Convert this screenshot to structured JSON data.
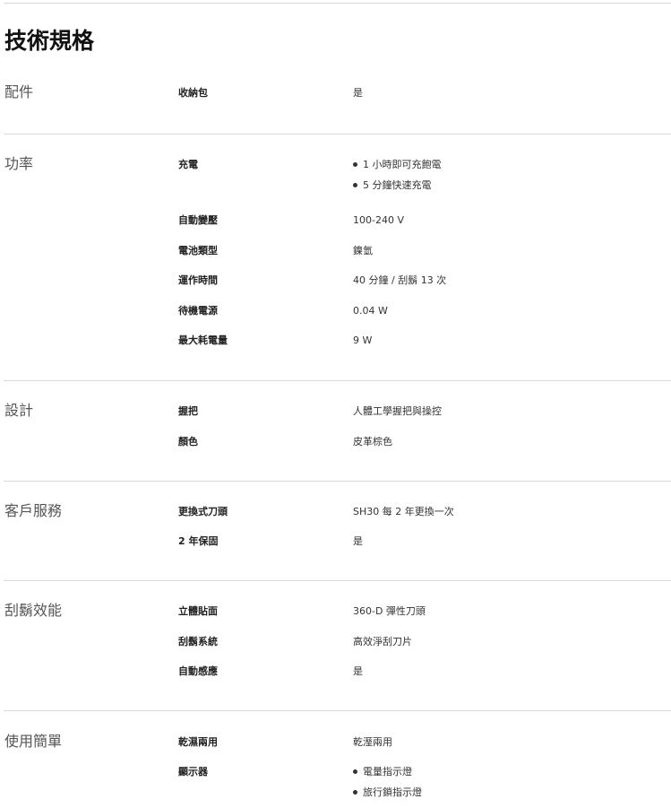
{
  "title": "技術規格",
  "sections": [
    {
      "name": "配件",
      "rows": [
        {
          "label": "收納包",
          "value": "是"
        }
      ]
    },
    {
      "name": "功率",
      "rows": [
        {
          "label": "充電",
          "bullets": [
            "1 小時即可充飽電",
            "5 分鐘快速充電"
          ]
        },
        {
          "label": "自動變壓",
          "value": "100-240 V"
        },
        {
          "label": "電池類型",
          "value": "鎳氫"
        },
        {
          "label": "運作時間",
          "value": "40 分鐘 / 刮鬍 13 次"
        },
        {
          "label": "待機電源",
          "value": "0.04  W"
        },
        {
          "label": "最大耗電量",
          "value": "9  W"
        }
      ]
    },
    {
      "name": "設計",
      "rows": [
        {
          "label": "握把",
          "value": "人體工學握把與操控"
        },
        {
          "label": "顏色",
          "value": "皮革棕色"
        }
      ]
    },
    {
      "name": "客戶服務",
      "rows": [
        {
          "label": "更換式刀頭",
          "value": "SH30 每 2 年更換一次"
        },
        {
          "label": "2 年保固",
          "value": "是"
        }
      ]
    },
    {
      "name": "刮鬍效能",
      "rows": [
        {
          "label": "立體貼面",
          "value": "360-D 彈性刀頭"
        },
        {
          "label": "刮鬍系統",
          "value": "高效淨刮刀片"
        },
        {
          "label": "自動感應",
          "value": "是"
        }
      ]
    },
    {
      "name": "使用簡單",
      "rows": [
        {
          "label": "乾濕兩用",
          "value": "乾溼兩用"
        },
        {
          "label": "顯示器",
          "bullets": [
            "電量指示燈",
            "旅行鎖指示燈"
          ]
        }
      ]
    }
  ]
}
